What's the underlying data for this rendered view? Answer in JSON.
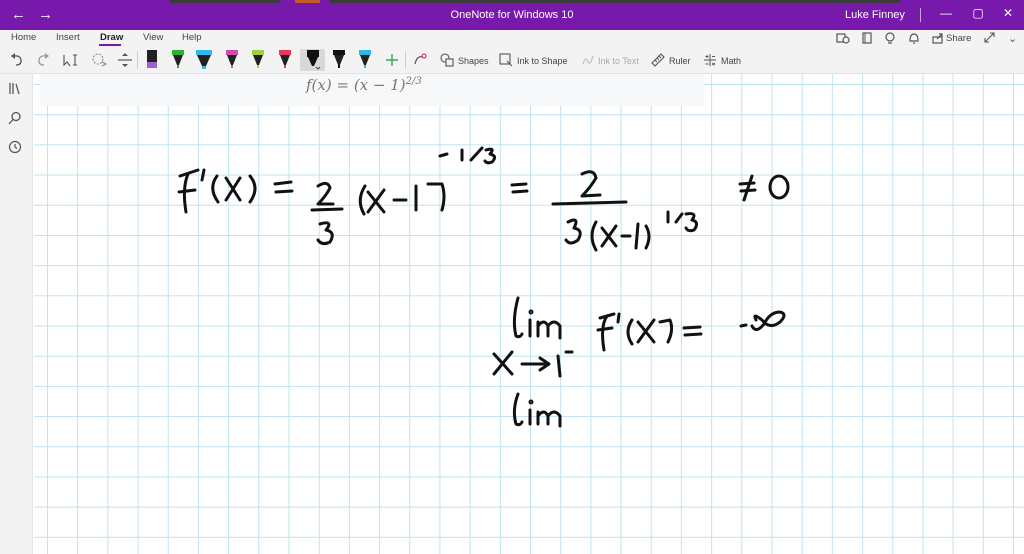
{
  "window": {
    "title": "OneNote for Windows 10",
    "user": "Luke Finney"
  },
  "menu": {
    "tabs": [
      {
        "label": "Home"
      },
      {
        "label": "Insert"
      },
      {
        "label": "Draw",
        "active": true
      },
      {
        "label": "View"
      },
      {
        "label": "Help"
      }
    ],
    "share_label": "Share"
  },
  "toolbar": {
    "shapes_label": "Shapes",
    "ink_to_shape_label": "Ink to Shape",
    "ink_to_text_label": "Ink to Text",
    "ruler_label": "Ruler",
    "math_label": "Math",
    "pens": [
      {
        "color": "#a060d0"
      },
      {
        "color": "#2fb02f"
      },
      {
        "color": "#32b8e8"
      },
      {
        "color": "#d04ab0"
      },
      {
        "color": "#9ed23c"
      },
      {
        "color": "#e8395a"
      },
      {
        "color": "#111111"
      },
      {
        "color": "#111111"
      },
      {
        "color": "#32b8e8"
      }
    ]
  },
  "page": {
    "formula_text": "f(x) = (x − 1)",
    "formula_exponent": "2/3"
  },
  "colors": {
    "accent": "#7719aa",
    "grid": "#bfe4f0",
    "ink": "#111111"
  }
}
